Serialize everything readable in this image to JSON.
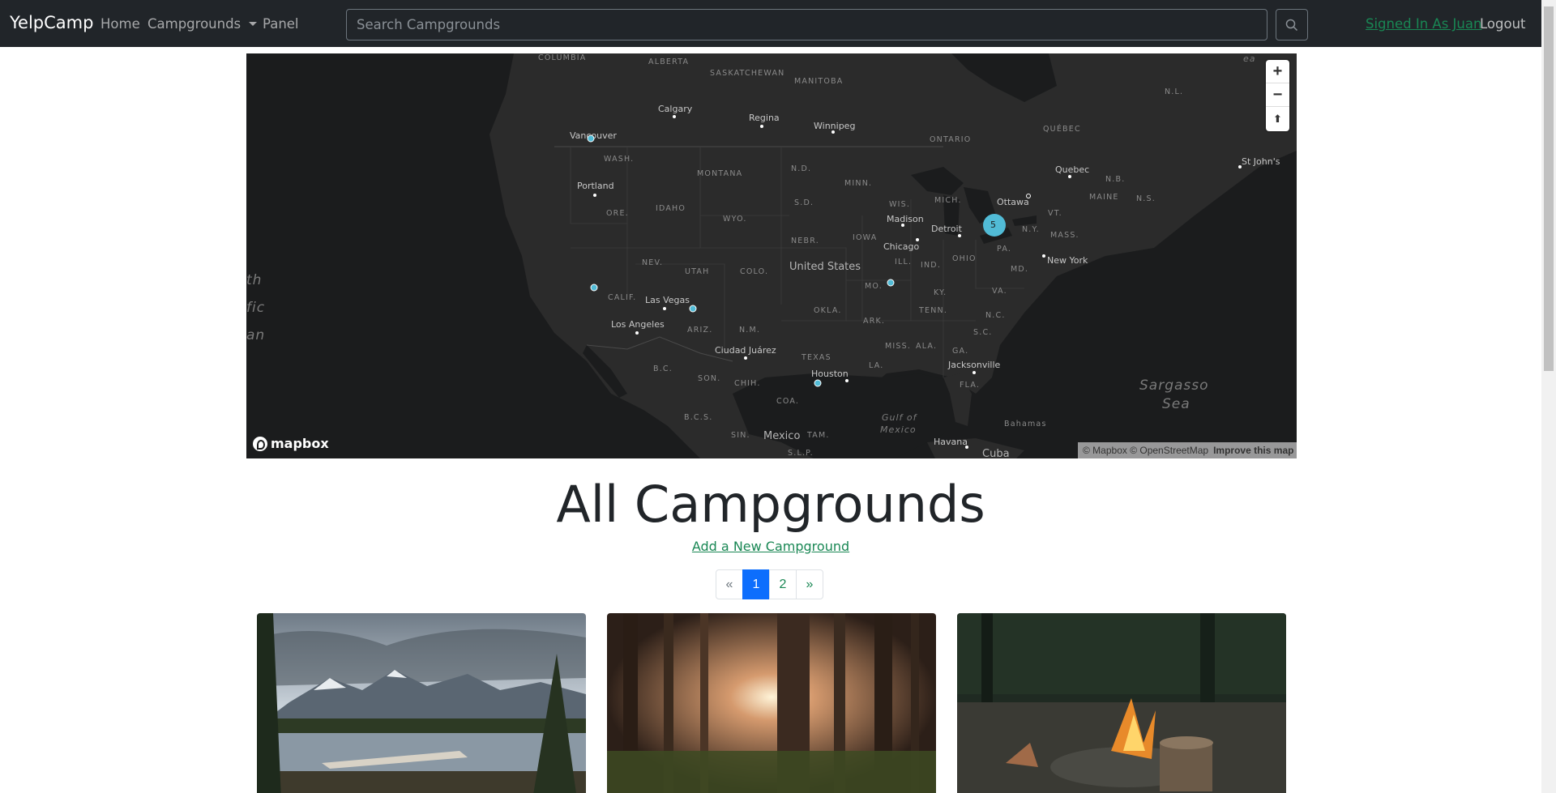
{
  "navbar": {
    "brand": "YelpCamp",
    "links": [
      {
        "label": "Home"
      },
      {
        "label": "Campgrounds"
      },
      {
        "label": "Panel"
      }
    ],
    "search_placeholder": "Search Campgrounds",
    "signed_in_label": "Signed In As Juan",
    "logout_label": "Logout"
  },
  "map": {
    "zoom_in": "+",
    "zoom_out": "−",
    "compass": "⬆",
    "labels": {
      "columbia": "COLUMBIA",
      "alberta": "ALBERTA",
      "saskatchewan": "SASKATCHEWAN",
      "manitoba": "MANITOBA",
      "ontario": "ONTARIO",
      "quebec_prov": "QUÉBEC",
      "nl": "N.L.",
      "calgary": "Calgary",
      "regina": "Regina",
      "winnipeg": "Winnipeg",
      "vancouver": "Vancouver",
      "wash": "WASH.",
      "montana": "MONTANA",
      "nd": "N.D.",
      "minn": "MINN.",
      "portland": "Portland",
      "ore": "ORE.",
      "idaho": "IDAHO",
      "wyo": "WYO.",
      "sd": "S.D.",
      "wis": "WIS.",
      "mich": "MICH.",
      "ottawa": "Ottawa",
      "quebec": "Quebec",
      "nb": "N.B.",
      "maine": "MAINE",
      "ns": "N.S.",
      "stjohns": "St John's",
      "madison": "Madison",
      "detroit": "Detroit",
      "vt": "VT.",
      "ny": "N.Y.",
      "mass": "MASS.",
      "nebr": "NEBR.",
      "iowa": "IOWA",
      "chicago": "Chicago",
      "nev": "NEV.",
      "utah": "UTAH",
      "colo": "COLO.",
      "united_states": "United States",
      "ill": "ILL.",
      "ind": "IND.",
      "ohio": "OHIO",
      "pa": "PA.",
      "newyork": "New York",
      "md": "MD.",
      "calif": "CALIF.",
      "lasvegas": "Las Vegas",
      "mo": "MO.",
      "ky": "KY.",
      "va": "VA.",
      "losangeles": "Los Angeles",
      "ariz": "ARIZ.",
      "nm": "N.M.",
      "okla": "OKLA.",
      "ark": "ARK.",
      "tenn": "TENN.",
      "nc": "N.C.",
      "sc": "S.C.",
      "ciudad": "Ciudad Juárez",
      "texas": "TEXAS",
      "miss": "MISS.",
      "ala": "ALA.",
      "ga": "GA.",
      "bc": "B.C.",
      "son": "SON.",
      "chih": "CHIH.",
      "houston": "Houston",
      "la": "LA.",
      "jacksonville": "Jacksonville",
      "fla": "FLA.",
      "coa": "COA.",
      "bcs": "B.C.S.",
      "sin": "SIN.",
      "mexico": "Mexico",
      "tam": "TAM.",
      "slp": "S.L.P.",
      "gulf": "Gulf of",
      "gulf2": "Mexico",
      "bahamas": "Bahamas",
      "havana": "Havana",
      "cuba": "Cuba",
      "sargasso": "Sargasso",
      "sea": "Sea",
      "pacific1": "th",
      "pacific2": "fic",
      "pacific3": "an",
      "ea": "ea"
    },
    "cluster_count": "5",
    "mapbox_logo": "mapbox",
    "attribution": "© Mapbox © OpenStreetMap",
    "improve": "Improve this map"
  },
  "main": {
    "title": "All Campgrounds",
    "add_link": "Add a New Campground"
  },
  "pagination": {
    "prev": "«",
    "pages": [
      "1",
      "2"
    ],
    "next": "»",
    "active": "1"
  },
  "colors": {
    "navbar_bg": "#212529",
    "accent_green": "#198754",
    "active_page": "#0d6efd",
    "map_marker": "#51bbd6"
  }
}
